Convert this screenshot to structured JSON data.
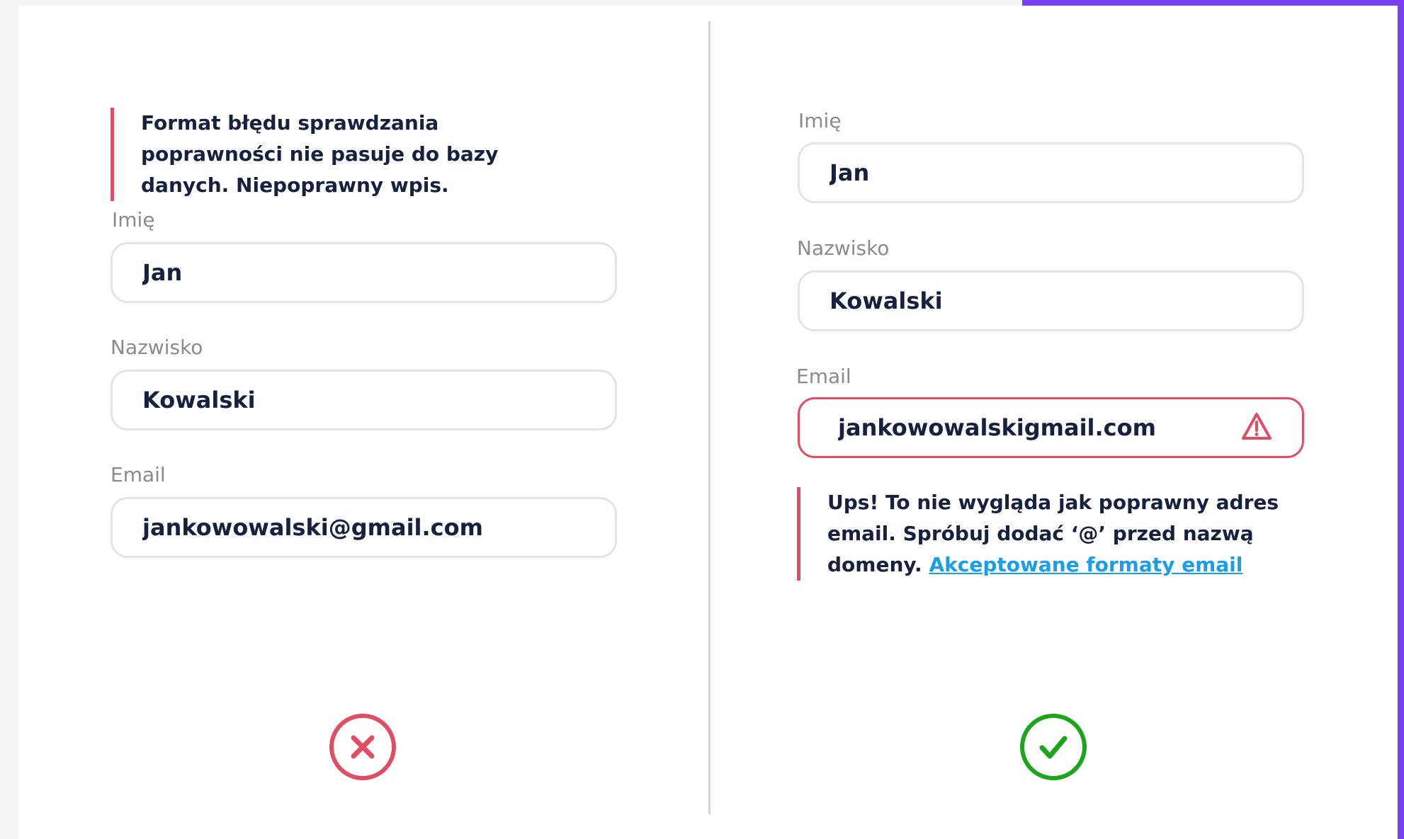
{
  "colors": {
    "accent": "#7b3ff2",
    "error": "#e04e65",
    "success": "#1aa51a",
    "text": "#16213f",
    "link": "#1a9ee8"
  },
  "left_panel": {
    "alert_message": "Format błędu sprawdzania poprawności nie pasuje do bazy danych. Niepoprawny wpis.",
    "first_name": {
      "label": "Imię",
      "value": "Jan"
    },
    "last_name": {
      "label": "Nazwisko",
      "value": "Kowalski"
    },
    "email": {
      "label": "Email",
      "value": "jankowowalski@gmail.com"
    },
    "verdict_icon": "x-circle-icon"
  },
  "right_panel": {
    "first_name": {
      "label": "Imię",
      "value": "Jan"
    },
    "last_name": {
      "label": "Nazwisko",
      "value": "Kowalski"
    },
    "email": {
      "label": "Email",
      "value": "jankowowalskigmail.com",
      "state_icon": "warning-triangle-icon"
    },
    "error_message": "Ups! To nie wygląda jak poprawny adres email. Spróbuj dodać ‘@’ przed nazwą domeny.",
    "error_link": "Akceptowane formaty email",
    "verdict_icon": "check-circle-icon"
  }
}
